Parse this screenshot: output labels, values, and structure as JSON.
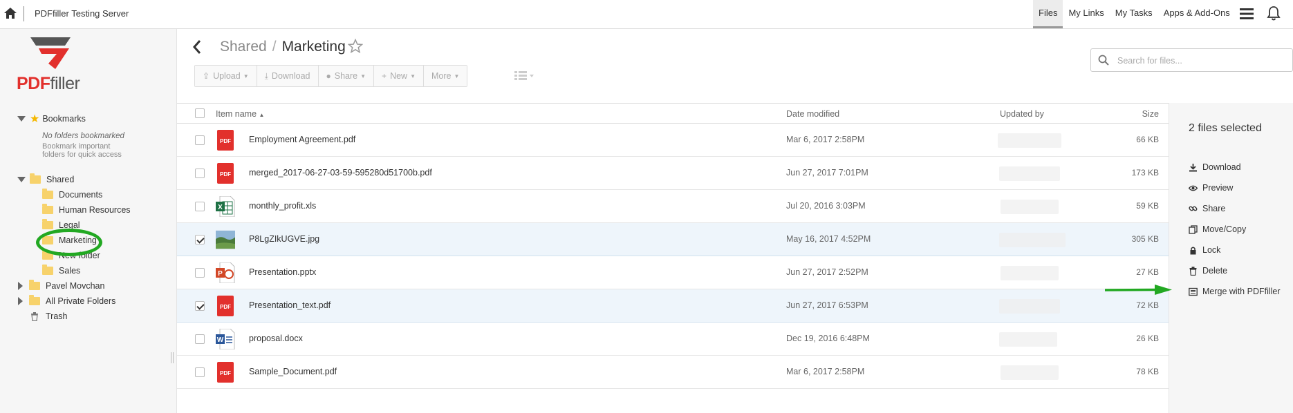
{
  "topbar": {
    "server_name": "PDFfiller Testing Server",
    "nav": [
      {
        "label": "Files",
        "active": true
      },
      {
        "label": "My Links",
        "active": false
      },
      {
        "label": "My Tasks",
        "active": false
      },
      {
        "label": "Apps & Add-Ons",
        "active": false
      }
    ]
  },
  "logo": {
    "part1": "PDF",
    "part2": "filler"
  },
  "sidebar": {
    "bookmarks_label": "Bookmarks",
    "no_bookmarks": "No folders bookmarked",
    "bookmark_hint_1": "Bookmark important",
    "bookmark_hint_2": "folders for quick access",
    "shared_label": "Shared",
    "shared_children": [
      "Documents",
      "Human Resources",
      "Legal",
      "Marketing",
      "New folder",
      "Sales"
    ],
    "other_items": [
      "Pavel Movchan",
      "All Private Folders"
    ],
    "trash_label": "Trash"
  },
  "breadcrumb": {
    "parent": "Shared",
    "separator": "/",
    "current": "Marketing"
  },
  "toolbar": {
    "upload": "Upload",
    "download": "Download",
    "share": "Share",
    "new": "New",
    "more": "More"
  },
  "search": {
    "placeholder": "Search for files..."
  },
  "list": {
    "headers": {
      "name": "Item name",
      "date": "Date modified",
      "updated": "Updated by",
      "size": "Size"
    },
    "rows": [
      {
        "name": "Employment Agreement.pdf",
        "type": "pdf",
        "date": "Mar 6, 2017 2:58PM",
        "size": "66 KB",
        "checked": false
      },
      {
        "name": "merged_2017-06-27-03-59-595280d51700b.pdf",
        "type": "pdf",
        "date": "Jun 27, 2017 7:01PM",
        "size": "173 KB",
        "checked": false
      },
      {
        "name": "monthly_profit.xls",
        "type": "xls",
        "date": "Jul 20, 2016 3:03PM",
        "size": "59 KB",
        "checked": false
      },
      {
        "name": "P8LgZIkUGVE.jpg",
        "type": "jpg",
        "date": "May 16, 2017 4:52PM",
        "size": "305 KB",
        "checked": true
      },
      {
        "name": "Presentation.pptx",
        "type": "pptx",
        "date": "Jun 27, 2017 2:52PM",
        "size": "27 KB",
        "checked": false
      },
      {
        "name": "Presentation_text.pdf",
        "type": "pdf",
        "date": "Jun 27, 2017 6:53PM",
        "size": "72 KB",
        "checked": true
      },
      {
        "name": "proposal.docx",
        "type": "docx",
        "date": "Dec 19, 2016 6:48PM",
        "size": "26 KB",
        "checked": false
      },
      {
        "name": "Sample_Document.pdf",
        "type": "pdf",
        "date": "Mar 6, 2017 2:58PM",
        "size": "78 KB",
        "checked": false
      }
    ]
  },
  "panel": {
    "selected": "2 files selected",
    "actions": [
      "Download",
      "Preview",
      "Share",
      "Move/Copy",
      "Lock",
      "Delete",
      "Merge with PDFfiller"
    ]
  },
  "colors": {
    "accent_red": "#e2302c",
    "highlight_green": "#22a822",
    "selected_row": "#eef5fb"
  }
}
